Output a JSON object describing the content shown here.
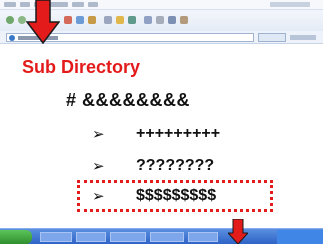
{
  "slide": {
    "title": "Sub Directory",
    "heading": "# &&&&&&&&",
    "bullets": [
      {
        "marker": "➢",
        "text": "+++++++++"
      },
      {
        "marker": "➢",
        "text": "????????"
      },
      {
        "marker": "➢",
        "text": "$$$$$$$$$"
      }
    ]
  },
  "colors": {
    "accent": "#e31b1b",
    "text": "#111111"
  }
}
